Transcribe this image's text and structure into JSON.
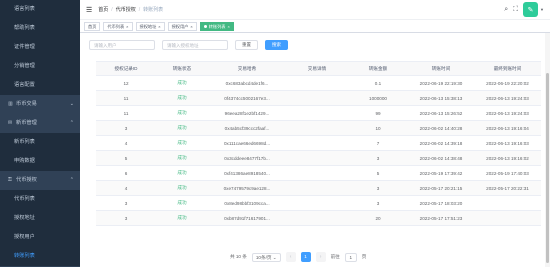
{
  "sidebar": {
    "items": [
      {
        "label": "语言列表",
        "type": "sub"
      },
      {
        "label": "帮助列表",
        "type": "sub"
      },
      {
        "label": "证件管理",
        "type": "sub"
      },
      {
        "label": "分销管理",
        "type": "sub"
      },
      {
        "label": "语言配置",
        "type": "sub"
      },
      {
        "label": "币币交易",
        "type": "group",
        "icon": "chart-icon",
        "arrow": "chevron-down-icon"
      },
      {
        "label": "新币管理",
        "type": "group",
        "icon": "gift-icon",
        "arrow": "chevron-up-icon"
      },
      {
        "label": "新币列表",
        "type": "sub"
      },
      {
        "label": "申购数据",
        "type": "sub"
      },
      {
        "label": "代币授权",
        "type": "group",
        "icon": "lock-icon",
        "arrow": "chevron-up-icon"
      },
      {
        "label": "代币列表",
        "type": "sub"
      },
      {
        "label": "授权地址",
        "type": "sub"
      },
      {
        "label": "授权用户",
        "type": "sub"
      },
      {
        "label": "转账列表",
        "type": "sub",
        "active": true
      }
    ]
  },
  "navbar": {
    "breadcrumb": [
      "首页",
      "代币授权",
      "转账列表"
    ]
  },
  "tags": [
    {
      "label": "首页",
      "closable": false,
      "active": false
    },
    {
      "label": "代币列表",
      "closable": true,
      "active": false
    },
    {
      "label": "授权地址",
      "closable": true,
      "active": false
    },
    {
      "label": "授权用户",
      "closable": true,
      "active": false
    },
    {
      "label": "转账列表",
      "closable": true,
      "active": true
    }
  ],
  "filters": {
    "user_placeholder": "请输入用户",
    "address_placeholder": "请输入授权地址",
    "reset_label": "重置",
    "search_label": "搜索"
  },
  "table": {
    "headers": [
      "授权记录ID",
      "转账状态",
      "交易哈希",
      "交易详情",
      "转账金额",
      "转账时间",
      "最终到账时间"
    ],
    "rows": [
      [
        "12",
        "成功",
        "0xc683abcd4de1f6...",
        "",
        "0.1",
        "2022-06-19 22:19:30",
        "2022-06-19 22:20:02"
      ],
      [
        "11",
        "成功",
        "0f4374cc5002167e3...",
        "",
        "1000000",
        "2022-06-13 15:38:13",
        "2022-06-13 19:24:03"
      ],
      [
        "11",
        "成功",
        "96eea28f1e2bf1429...",
        "",
        "99",
        "2022-06-13 15:26:52",
        "2022-06-13 19:24:03"
      ],
      [
        "3",
        "成功",
        "0x4ab5cf39ccc2faaf...",
        "",
        "10",
        "2022-06-02 14:40:28",
        "2022-06-13 19:16:04"
      ],
      [
        "4",
        "成功",
        "0x111cae66ed6698d...",
        "",
        "7",
        "2022-06-02 14:39:18",
        "2022-06-13 19:16:03"
      ],
      [
        "5",
        "成功",
        "0x3cddeee8477f17b...",
        "",
        "3",
        "2022-06-02 14:38:48",
        "2022-06-13 19:16:02"
      ],
      [
        "6",
        "成功",
        "0xf41386ae8918540...",
        "",
        "5",
        "2022-05-19 17:39:42",
        "2022-05-19 17:40:03"
      ],
      [
        "4",
        "成功",
        "0xe7479579c9ae128...",
        "",
        "3",
        "2022-05-17 20:21:15",
        "2022-05-17 20:22:31"
      ],
      [
        "3",
        "成功",
        "0x8ed98bbf3109cca...",
        "",
        "3",
        "2022-05-17 18:03:20",
        ""
      ],
      [
        "3",
        "成功",
        "0xb87d91f71617901...",
        "",
        "20",
        "2022-05-17 17:51:23",
        ""
      ]
    ]
  },
  "pager": {
    "total": "共 10 条",
    "page_size": "10条/页",
    "prev": "‹",
    "current": "1",
    "next": "›",
    "goto": "前往",
    "page_input": "1",
    "page_unit": "页"
  }
}
